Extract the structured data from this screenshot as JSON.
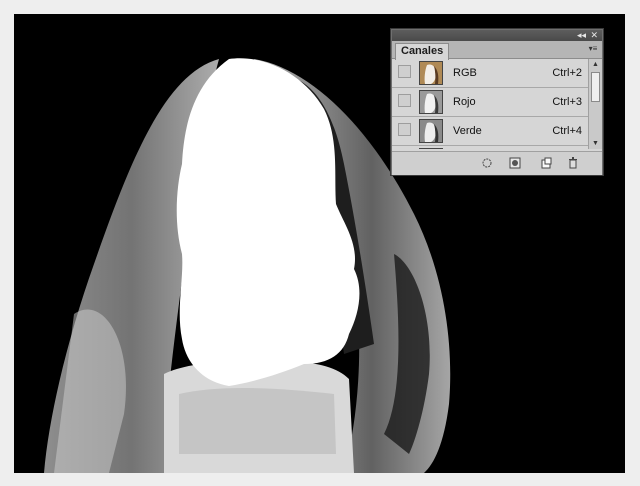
{
  "panel": {
    "tab_label": "Canales",
    "collapse_icon": "double-chevron-left",
    "close_icon": "close",
    "menu_icon": "panel-menu",
    "channels": [
      {
        "name": "RGB",
        "shortcut": "Ctrl+2",
        "thumb": "color"
      },
      {
        "name": "Rojo",
        "shortcut": "Ctrl+3",
        "thumb": "gray"
      },
      {
        "name": "Verde",
        "shortcut": "Ctrl+4",
        "thumb": "gray"
      },
      {
        "name": "",
        "shortcut": "",
        "thumb": "gray"
      }
    ],
    "bottom_icons": [
      "load-selection-icon",
      "save-selection-icon",
      "new-channel-icon",
      "delete-channel-icon"
    ]
  },
  "colors": {
    "canvas_bg": "#000000",
    "panel_bg": "#d6d6d6",
    "panel_header": "#4d4d4d"
  }
}
